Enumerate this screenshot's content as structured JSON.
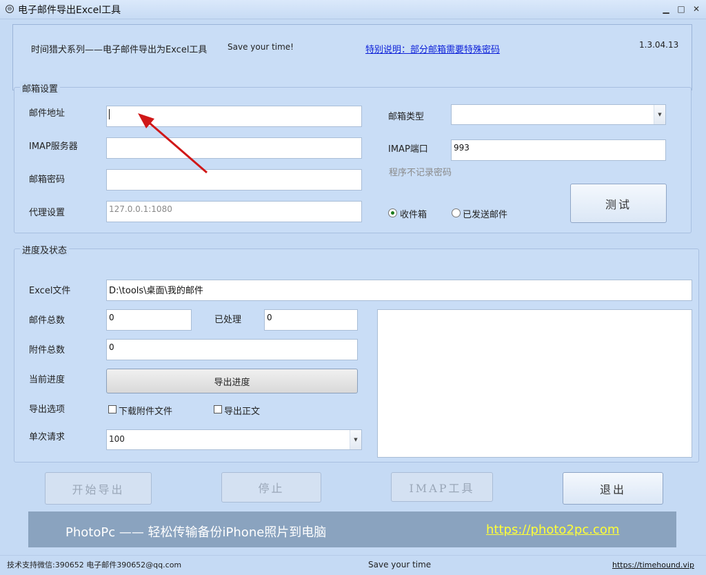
{
  "window": {
    "title": "电子邮件导出Excel工具",
    "controls": {
      "minimize": "▁",
      "maximize": "□",
      "close": "✕"
    }
  },
  "header": {
    "series_text": "时间猎犬系列——电子邮件导出为Excel工具",
    "slogan": "Save your time!",
    "note_link": "特别说明：部分邮箱需要特殊密码",
    "version": "1.3.04.13"
  },
  "mail_settings": {
    "group_title": "邮箱设置",
    "email_label": "邮件地址",
    "email_value": "",
    "imap_server_label": "IMAP服务器",
    "imap_server_value": "",
    "password_label": "邮箱密码",
    "password_value": "",
    "proxy_label": "代理设置",
    "proxy_placeholder": "127.0.0.1:1080",
    "mailbox_type_label": "邮箱类型",
    "mailbox_type_value": "",
    "imap_port_label": "IMAP端口",
    "imap_port_value": "993",
    "password_note": "程序不记录密码",
    "test_button": "测试",
    "radio_inbox": "收件箱",
    "radio_sent": "已发送邮件"
  },
  "progress": {
    "group_title": "进度及状态",
    "excel_label": "Excel文件",
    "excel_value": "D:\\tools\\桌面\\我的邮件",
    "total_mails_label": "邮件总数",
    "total_mails_value": "0",
    "processed_label": "已处理",
    "processed_value": "0",
    "total_attach_label": "附件总数",
    "total_attach_value": "0",
    "current_progress_label": "当前进度",
    "progress_bar_text": "导出进度",
    "export_options_label": "导出选项",
    "opt_download_attach": "下载附件文件",
    "opt_export_body": "导出正文",
    "batch_label": "单次请求",
    "batch_value": "100"
  },
  "actions": {
    "start": "开始导出",
    "stop": "停止",
    "imap_tool": "IMAP工具",
    "exit": "退出"
  },
  "banner": {
    "text": "PhotoPc —— 轻松传输备份iPhone照片到电脑",
    "link": "https://photo2pc.com"
  },
  "status": {
    "support": "技术支持微信:390652  电子邮件390652@qq.com",
    "slogan": "Save your time",
    "site": "https://timehound.vip"
  },
  "colors": {
    "accent_link": "#0a1ed8",
    "banner_bg": "#8aa3bf",
    "banner_link": "#ffff36",
    "arrow": "#d01818"
  }
}
